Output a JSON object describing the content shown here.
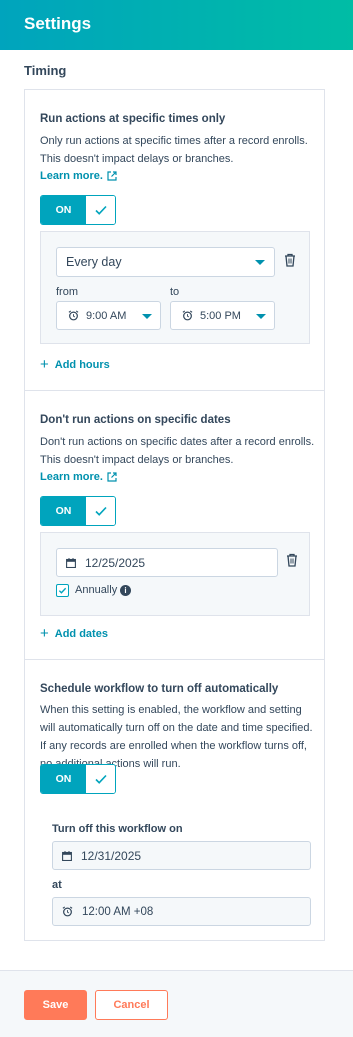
{
  "header": {
    "title": "Settings"
  },
  "section": {
    "heading": "Timing"
  },
  "times_block": {
    "title": "Run actions at specific times only",
    "description": "Only run actions at specific times after a record enrolls. This doesn't impact delays or branches.",
    "learn_more": "Learn more.",
    "toggle_label": "ON",
    "frequency": "Every day",
    "from_label": "from",
    "to_label": "to",
    "from_time": "9:00 AM",
    "to_time": "5:00 PM",
    "add_hours": "Add hours"
  },
  "dates_block": {
    "title": "Don't run actions on specific dates",
    "description": "Don't run actions on specific dates after a record enrolls. This doesn't impact delays or branches.",
    "learn_more": "Learn more.",
    "toggle_label": "ON",
    "date": "12/25/2025",
    "annually_label": "Annually",
    "annually_checked": true,
    "add_dates": "Add dates"
  },
  "schedule_block": {
    "title": "Schedule workflow to turn off automatically",
    "description": "When this setting is enabled, the workflow and setting will automatically turn off on the date and time specified. If any records are enrolled when the workflow turns off, no additional actions will run.",
    "toggle_label": "ON",
    "turn_off_label": "Turn off this workflow on",
    "turn_off_date": "12/31/2025",
    "at_label": "at",
    "turn_off_time": "12:00 AM +08"
  },
  "footer": {
    "save": "Save",
    "cancel": "Cancel"
  },
  "colors": {
    "accent": "#00a4bd",
    "link": "#0091ae",
    "save": "#ff7a59"
  }
}
